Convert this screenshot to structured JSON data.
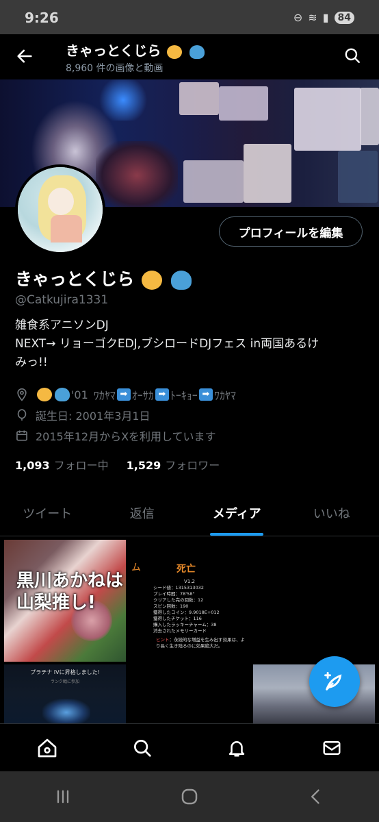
{
  "status": {
    "time": "9:26",
    "battery": "84"
  },
  "header": {
    "name": "きゃっとくじら",
    "media_count": "8,960 件の画像と動画",
    "name_emojis": [
      "cat-face",
      "whale"
    ]
  },
  "profile": {
    "edit_button": "プロフィールを編集",
    "display_name": "きゃっとくじら",
    "handle": "@Catkujira1331",
    "bio_lines": [
      "雑食系アニソンDJ",
      "NEXT→ リョーゴクEDJ,ブシロードDJフェス in両国あるけ",
      "みっ!!"
    ],
    "location": {
      "year": "'01",
      "places": [
        "ﾜｶﾔﾏ",
        "ｵｰｻｶ",
        "ﾄｰｷｮｰ",
        "ﾜｶﾔﾏ"
      ],
      "arrow": "➡"
    },
    "birthday": "誕生日: 2001年3月1日",
    "joined": "2015年12月からXを利用しています",
    "following_count": "1,093",
    "following_label": "フォロー中",
    "followers_count": "1,529",
    "followers_label": "フォロワー"
  },
  "tabs": [
    {
      "label": "ツイート"
    },
    {
      "label": "返信"
    },
    {
      "label": "メディア",
      "active": true
    },
    {
      "label": "いいね"
    }
  ],
  "media": {
    "tile1_text": [
      "黒川あかねは",
      "山梨推し!"
    ],
    "tile2": {
      "title": "死亡",
      "left_mark": "ム",
      "version": "V1.2",
      "lines": [
        "シード値：1315313032",
        "プレイ時間：78'58\"",
        "クリアした完の回数：12",
        "スピン回数：190",
        "獲得したコイン：9.9018E+012",
        "獲得したチケット：116",
        "購入したラッキーチャーム：38",
        "消去されたメモリーカード"
      ],
      "hint_label": "ヒント",
      "hint": "：永続的な増益を生み出す効果は、より長く生き残るのに効果絶大だ。"
    },
    "tile4": {
      "title": "プラチナ IVに昇格しました!",
      "sub": "ランク戦に参加"
    }
  },
  "colors": {
    "accent": "#1d9bf0",
    "background": "#000000",
    "muted": "#71767b"
  },
  "icons": {
    "back": "arrow-left-icon",
    "search": "search-icon",
    "compose": "compose-icon",
    "home": "home-icon",
    "nav_search": "search-icon",
    "notifications": "bell-icon",
    "messages": "mail-icon"
  }
}
